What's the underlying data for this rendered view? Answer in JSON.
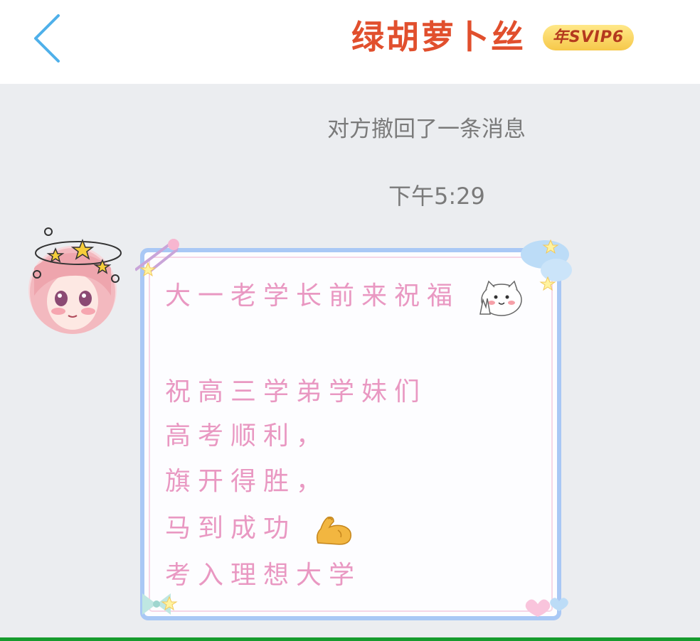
{
  "header": {
    "title": "绿胡萝卜丝",
    "vip_badge": "年SVIP6",
    "back_icon": "chevron-left-icon"
  },
  "chat": {
    "recall_notice": "对方撤回了一条消息",
    "timestamp": "下午5:29",
    "message": {
      "lines": [
        "大一老学长前来祝福",
        "",
        "祝高三学弟学妹们",
        "高考顺利，",
        "旗开得胜，",
        "马到成功",
        "考入理想大学"
      ],
      "emojis": [
        "cat-peace-sticker-icon",
        "flexed-biceps-icon"
      ]
    }
  },
  "colors": {
    "title": "#e14f2d",
    "message_text": "#e998c2",
    "bubble_border": "#a9c8f5",
    "background": "#ebedf0"
  }
}
